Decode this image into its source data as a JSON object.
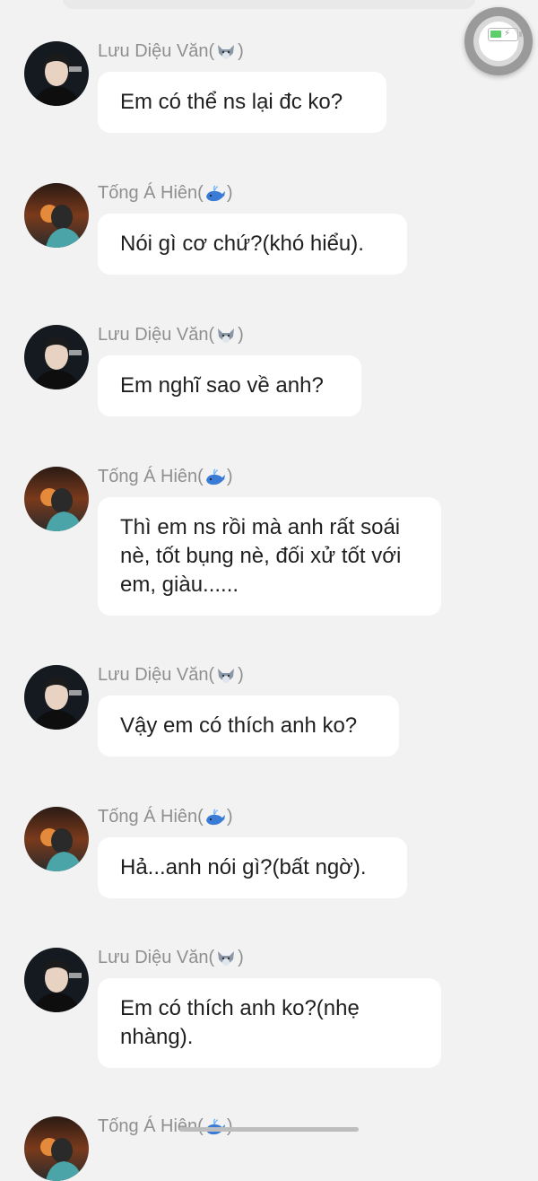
{
  "chat": {
    "messages": [
      {
        "sender": "Lưu Diệu Văn",
        "emoji": "wolf-emoji",
        "avatar": "boy-avatar",
        "text": "Em có thể ns lại đc ko?"
      },
      {
        "sender": "Tống Á Hiên",
        "emoji": "whale-emoji",
        "avatar": "sunset-avatar",
        "text": "Nói gì cơ chứ?(khó hiểu)."
      },
      {
        "sender": "Lưu Diệu Văn",
        "emoji": "wolf-emoji",
        "avatar": "boy-avatar",
        "text": "Em nghĩ sao về anh?"
      },
      {
        "sender": "Tống Á Hiên",
        "emoji": "whale-emoji",
        "avatar": "sunset-avatar",
        "text": "Thì em ns rồi mà anh rất soái nè, tốt bụng nè, đối xử tốt với em, giàu......"
      },
      {
        "sender": "Lưu Diệu Văn",
        "emoji": "wolf-emoji",
        "avatar": "boy-avatar",
        "text": "Vậy em có thích anh ko?"
      },
      {
        "sender": "Tống Á Hiên",
        "emoji": "whale-emoji",
        "avatar": "sunset-avatar",
        "text": "Hả...anh nói gì?(bất ngờ)."
      },
      {
        "sender": "Lưu Diệu Văn",
        "emoji": "wolf-emoji",
        "avatar": "boy-avatar",
        "text": "Em có thích anh ko?(nhẹ nhàng)."
      },
      {
        "sender": "Tống Á Hiên",
        "emoji": "whale-emoji",
        "avatar": "sunset-avatar",
        "text": ""
      }
    ]
  },
  "colors": {
    "background": "#f2f2f2",
    "bubble": "#ffffff",
    "name_text": "#8f8f8f",
    "message_text": "#1f1f1f"
  },
  "icons": {
    "floating_button": "assistive-touch-icon",
    "battery": "battery-charging-icon"
  }
}
